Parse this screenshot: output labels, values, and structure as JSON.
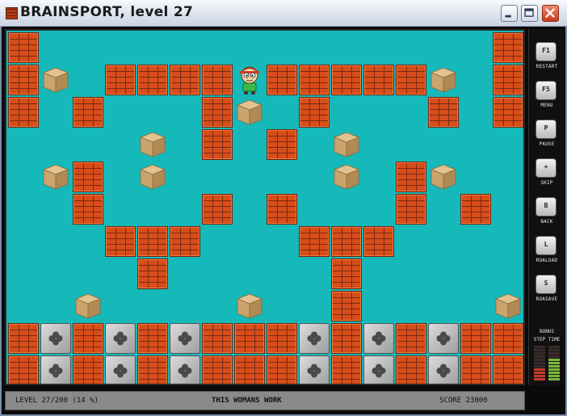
{
  "window": {
    "title": "BRAINSPORT, level 27",
    "icon": "brick-icon",
    "controls": [
      "minimize-icon",
      "maximize-icon",
      "close-icon"
    ]
  },
  "board": {
    "background_color": "#16b9b9",
    "grid": [
      "B..............BB",
      "BC.BBBBPBBBBBC.BB",
      "B.B...BC.B...B.B.",
      "....C.B.B.C......",
      ".CB.C.....C.BC...",
      "..B...B.B...B.B..",
      "...BBB...BBB....B",
      "....B.....B......",
      "..C....C..B....C.",
      "BMBMBMBBBMBMBMBBB",
      "BMBMBMBBBMBMBMBBB"
    ],
    "legend": {
      "B": "brick",
      "C": "crate",
      "M": "metal-clover",
      "P": "player",
      ".": "empty"
    }
  },
  "sidebar": {
    "keys": [
      {
        "key": "F1",
        "label": "RESTART"
      },
      {
        "key": "F5",
        "label": "MENU"
      },
      {
        "key": "P",
        "label": "PAUSE"
      },
      {
        "key": "+",
        "label": "SKIP"
      },
      {
        "key": "B",
        "label": "BACK"
      },
      {
        "key": "L",
        "label": "ROALOAD"
      },
      {
        "key": "S",
        "label": "ROASAVE"
      }
    ],
    "bonus": {
      "title": "BONUS",
      "step_label": "STEP",
      "time_label": "TIME",
      "step_level": 0.35,
      "time_level": 0.6
    }
  },
  "status": {
    "level": "LEVEL 27/200 (14 %)",
    "message": "THIS WOMANS WORK",
    "score": "SCORE 23000"
  }
}
